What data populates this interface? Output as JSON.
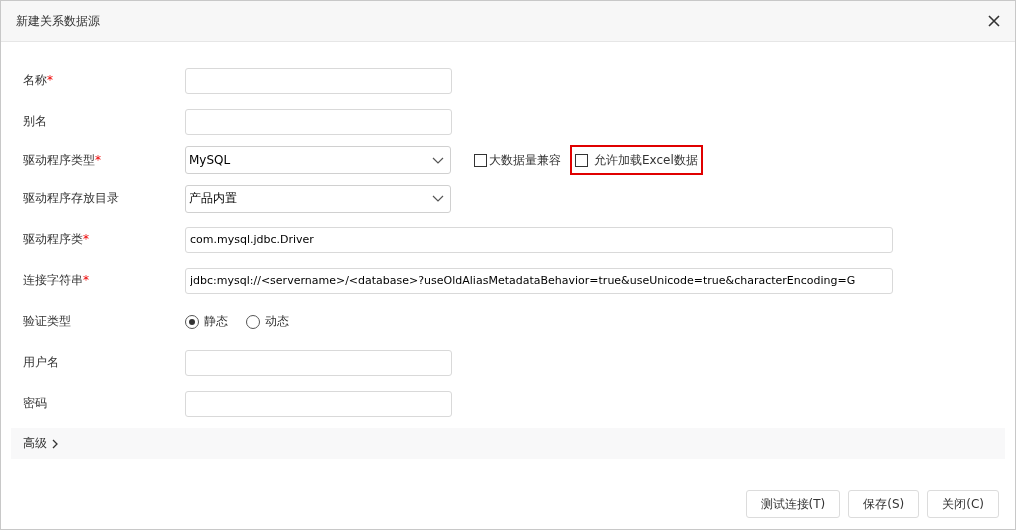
{
  "window": {
    "title": "新建关系数据源"
  },
  "rows": [
    {
      "kind": "text",
      "label": "名称",
      "required_mark": "*"
    },
    {
      "kind": "text",
      "label": "别名"
    },
    {
      "kind": "select",
      "label": "驱动程序类型",
      "required_mark": "*",
      "value": "MySQL",
      "checkboxes": [
        {
          "label": "大数据量兼容",
          "checked": false,
          "highlighted": false
        },
        {
          "label": "允许加载Excel数据",
          "checked": false,
          "highlighted": true
        }
      ]
    },
    {
      "kind": "select",
      "label": "驱动程序存放目录",
      "value": "产品内置"
    },
    {
      "kind": "wide",
      "label": "驱动程序类",
      "required_mark": "*",
      "value": "com.mysql.jdbc.Driver"
    },
    {
      "kind": "wide",
      "label": "连接字符串",
      "required_mark": "*",
      "value": "jdbc:mysql://<servername>/<database>?useOldAliasMetadataBehavior=true&useUnicode=true&characterEncoding=G"
    },
    {
      "kind": "radio",
      "label": "验证类型",
      "options": [
        {
          "label": "静态",
          "selected": true
        },
        {
          "label": "动态",
          "selected": false
        }
      ]
    },
    {
      "kind": "text",
      "label": "用户名"
    },
    {
      "kind": "text",
      "label": "密码"
    }
  ],
  "advanced": {
    "label": "高级",
    "expanded": false
  },
  "buttons": [
    "测试连接(T)",
    "保存(S)",
    "关闭(C)"
  ]
}
